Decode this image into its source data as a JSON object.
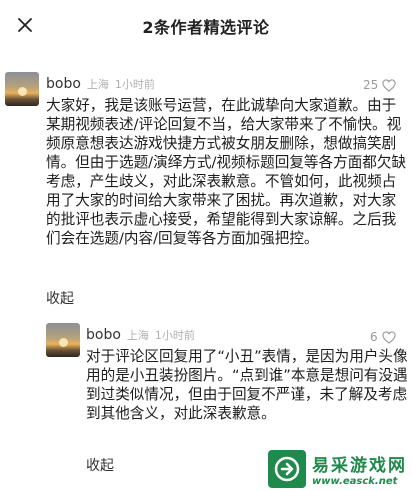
{
  "header": {
    "title": "2条作者精选评论"
  },
  "comments": [
    {
      "username": "bobo",
      "region": "上海",
      "time": "1小时前",
      "likes": "25",
      "text": "大家好，我是该账号运营，在此诚挚向大家道歉。由于某期视频表述/评论回复不当，给大家带来了不愉快。视频原意想表达游戏快捷方式被女朋友删除，想做搞笑剧情。但由于选题/演绎方式/视频标题回复等各方面都欠缺考虑，产生歧义，对此深表歉意。不管如何，此视频占用了大家的时间给大家带来了困扰。再次道歉，对大家的批评也表示虚心接受，希望能得到大家谅解。之后我们会在选题/内容/回复等各方面加强把控。",
      "collapse": "收起"
    },
    {
      "username": "bobo",
      "region": "上海",
      "time": "1小时前",
      "likes": "6",
      "text": "对于评论区回复用了“小丑”表情，是因为用户头像用的是小丑装扮图片。“点到谁”本意是想问有没遇到过类似情况，但由于回复不严谨，未了解及考虑到其他含义，对此深表歉意。",
      "collapse": "收起"
    }
  ],
  "watermark": {
    "name": "易采游戏网",
    "url": "www.easck.net"
  }
}
